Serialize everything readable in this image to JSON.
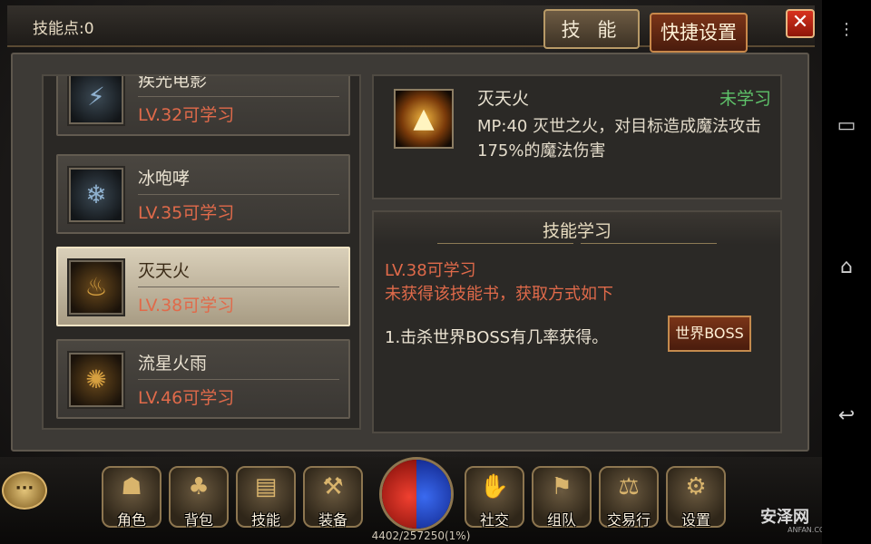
{
  "header": {
    "skill_points": "技能点:0",
    "tab_skill": "技 能",
    "tab_shortcut": "快捷设置",
    "close": "✕"
  },
  "skill_list": [
    {
      "name": "疾光电影",
      "level": "LV.32可学习",
      "icon": "lightning-skill-icon"
    },
    {
      "name": "冰咆哮",
      "level": "LV.35可学习",
      "icon": "ice-skill-icon"
    },
    {
      "name": "灭天火",
      "level": "LV.38可学习",
      "icon": "fire-skill-icon",
      "selected": true
    },
    {
      "name": "流星火雨",
      "level": "LV.46可学习",
      "icon": "meteor-skill-icon"
    }
  ],
  "detail": {
    "title": "灭天火",
    "status": "未学习",
    "desc": "MP:40  灭世之火，对目标造成魔法攻击175%的魔法伤害"
  },
  "learn": {
    "header": "技能学习",
    "level_req": "LV.38可学习",
    "book_note": "未获得该技能书，获取方式如下",
    "method": "1.击杀世界BOSS有几率获得。",
    "boss_button": "世界BOSS"
  },
  "bottom_nav": {
    "chat": "···",
    "role": "角色",
    "bag": "背包",
    "skill": "技能",
    "equip": "装备",
    "social": "社交",
    "team": "组队",
    "trade": "交易行",
    "settings": "设置"
  },
  "exp_text": "4402/257250(1%)",
  "watermark": {
    "main": "安泽网",
    "sub": "ANFAN.COM"
  },
  "colors": {
    "accent_red": "#e06a4a",
    "status_green": "#5fc36a",
    "gold_border": "#b89a67"
  }
}
